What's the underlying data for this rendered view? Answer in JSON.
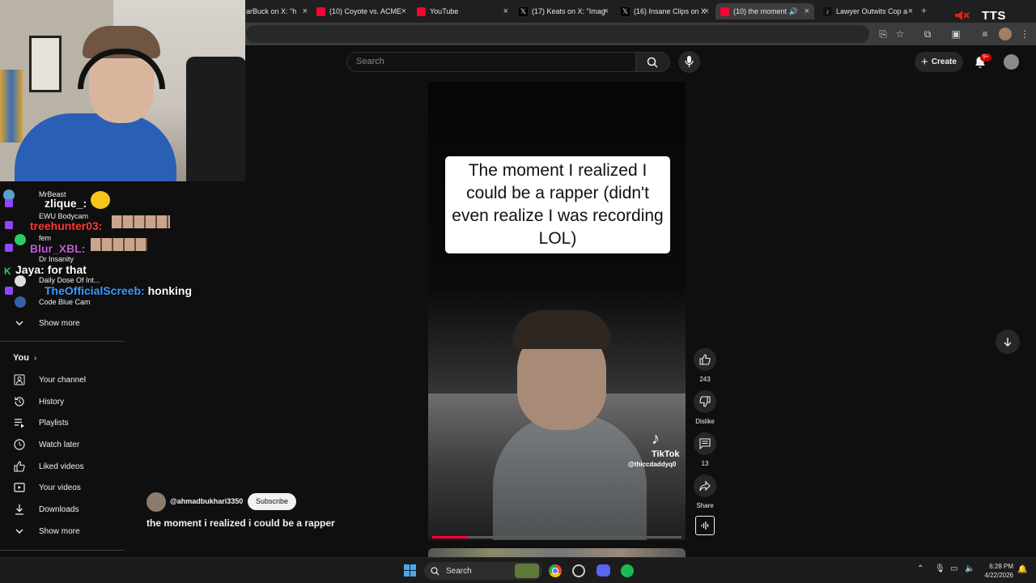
{
  "tabs": [
    {
      "label": "arBuck on X: \"h",
      "color": "#e8e8e8"
    },
    {
      "label": "(10) Coyote vs. ACME",
      "color": "#ff0033"
    },
    {
      "label": "YouTube",
      "color": "#ff0033"
    },
    {
      "label": "(17) Keats on X: \"Imag",
      "color": "#e8e8e8"
    },
    {
      "label": "(16) Insane Clips on X",
      "color": "#e8e8e8"
    },
    {
      "label": "(10) the moment",
      "color": "#ff0033"
    },
    {
      "label": "Lawyer Outwits Cop a",
      "color": "#e8e8e8"
    }
  ],
  "overlay": {
    "tts": "TTS"
  },
  "header": {
    "search_placeholder": "Search",
    "create_label": "Create",
    "notif_count": "9+"
  },
  "chat": [
    {
      "user": "zlique_:",
      "msg": "",
      "color": "#ffffff"
    },
    {
      "user": "treehunter03:",
      "msg": "",
      "color": "#ff3a2e"
    },
    {
      "user": "Blur_XBL:",
      "msg": "",
      "color": "#c05bd6"
    },
    {
      "user": "Jaya:",
      "msg": " for that",
      "color": "#ffffff"
    },
    {
      "user": "TheOfficialScreeb:",
      "msg": " honking",
      "color": "#3d9cff"
    }
  ],
  "subscriptions": [
    "MrBeast",
    "EWU Bodycam",
    "fem",
    "Dr Insanity",
    "Daily Dose Of Int...",
    "Code Blue Cam"
  ],
  "sidebar": {
    "show_more_1": "Show more",
    "you_label": "You",
    "items": [
      "Your channel",
      "History",
      "Playlists",
      "Watch later",
      "Liked videos",
      "Your videos",
      "Downloads"
    ],
    "show_more_2": "Show more"
  },
  "video": {
    "caption": "The moment I realized I could be a rapper (didn't even realize I was recording LOL)",
    "watermark_brand": "TikTok",
    "watermark_handle": "@thiccdaddyq0",
    "channel": "@ahmadbukhari3350",
    "subscribe_label": "Subscribe",
    "title": "the moment i realized i could be a rapper",
    "progress": 0.14
  },
  "actions": {
    "likes": "243",
    "dislike_label": "Dislike",
    "comments": "13",
    "share_label": "Share"
  },
  "taskbar": {
    "search_label": "Search",
    "time": "6:28 PM",
    "date": "4/22/2026"
  }
}
